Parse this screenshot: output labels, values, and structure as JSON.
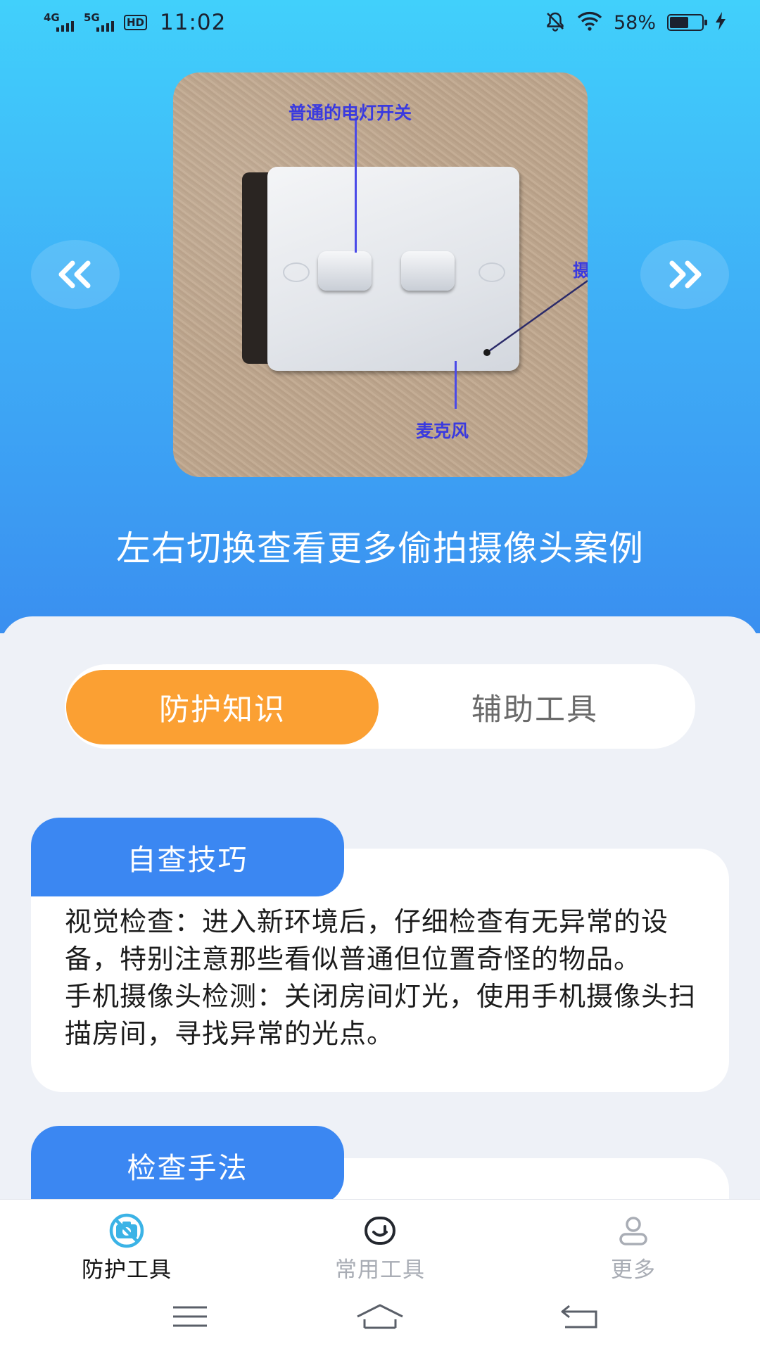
{
  "status_bar": {
    "network_1": "4G",
    "network_2": "5G",
    "hd": "HD",
    "time": "11:02",
    "battery_percent": "58%",
    "battery_level": 0.58,
    "icons": [
      "mute-icon",
      "wifi-icon",
      "battery-icon",
      "charging-icon"
    ]
  },
  "hero": {
    "image_labels": {
      "top": "普通的电灯开关",
      "bottom": "麦克风",
      "right_cropped": "摄"
    },
    "prev_icon": "double-chevron-left-icon",
    "next_icon": "double-chevron-right-icon",
    "caption": "左右切换查看更多偷拍摄像头案例"
  },
  "tabs": [
    {
      "label": "防护知识",
      "active": true
    },
    {
      "label": "辅助工具",
      "active": false
    }
  ],
  "cards": [
    {
      "title": "自查技巧",
      "body": "视觉检查：进入新环境后，仔细检查有无异常的设备，特别注意那些看似普通但位置奇怪的物品。\n手机摄像头检测：关闭房间灯光，使用手机摄像头扫描房间，寻找异常的光点。"
    },
    {
      "title": "检查手法",
      "body": ""
    }
  ],
  "bottom_nav": [
    {
      "label": "防护工具",
      "icon": "camera-block-icon",
      "active": true
    },
    {
      "label": "常用工具",
      "icon": "smile-icon",
      "active": false
    },
    {
      "label": "更多",
      "icon": "person-icon",
      "active": false
    }
  ],
  "system_nav": [
    "menu-icon",
    "home-icon",
    "back-icon"
  ],
  "colors": {
    "accent_orange": "#fba033",
    "accent_blue": "#3b87f2",
    "hero_gradient_top": "#41d0fb",
    "hero_gradient_bottom": "#3a8ff0",
    "active_nav_icon": "#3bb3e6"
  }
}
